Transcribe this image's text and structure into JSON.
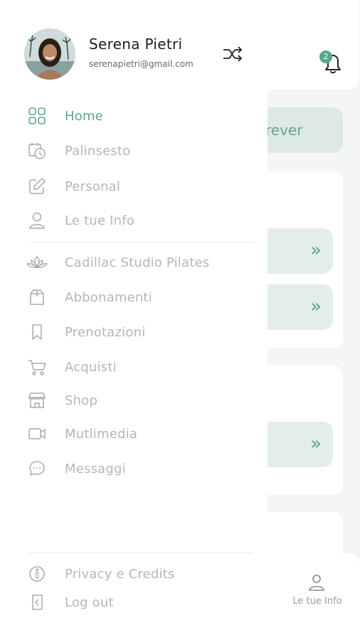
{
  "user": {
    "name": "Serena Pietri",
    "email": "serenapietri@gmail.com"
  },
  "menu_primary": [
    {
      "label": "Home",
      "icon": "grid-icon",
      "active": true
    },
    {
      "label": "Palinsesto",
      "icon": "calendar-clock-icon",
      "active": false
    },
    {
      "label": "Personal",
      "icon": "edit-icon",
      "active": false
    },
    {
      "label": "Le tue Info",
      "icon": "user-icon",
      "active": false
    }
  ],
  "menu_secondary": [
    {
      "label": "Cadillac Studio Pilates",
      "icon": "lotus-icon"
    },
    {
      "label": "Abbonamenti",
      "icon": "box-icon"
    },
    {
      "label": "Prenotazioni",
      "icon": "bookmark-icon"
    },
    {
      "label": "Acquisti",
      "icon": "cart-icon"
    },
    {
      "label": "Shop",
      "icon": "store-icon"
    },
    {
      "label": "Mutlimedia",
      "icon": "video-icon"
    },
    {
      "label": "Messaggi",
      "icon": "chat-icon"
    }
  ],
  "menu_footer": [
    {
      "label": "Privacy e Credits",
      "icon": "info-icon"
    },
    {
      "label": "Log out",
      "icon": "logout-icon"
    }
  ],
  "background": {
    "notification_count": "2",
    "banner_text": "rever",
    "bottom_nav_label": "Le tue Info"
  },
  "colors": {
    "accent": "#5aa590",
    "inactive": "#b6b6b6",
    "surface": "#ffffff",
    "page": "#f3f5f6"
  }
}
